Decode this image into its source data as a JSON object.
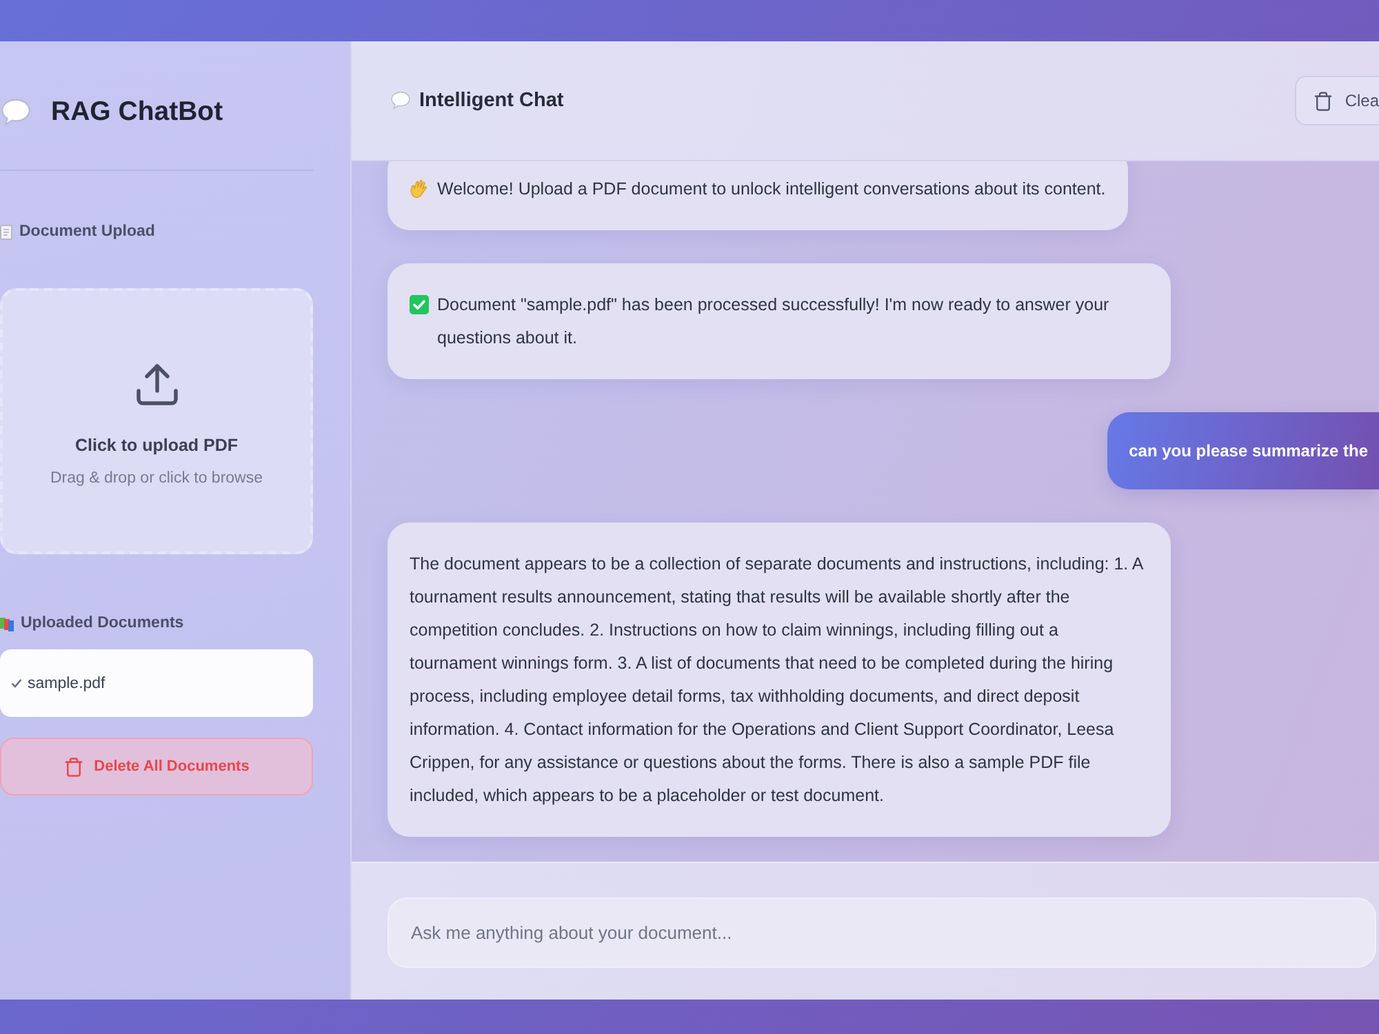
{
  "sidebar": {
    "title": "RAG ChatBot",
    "upload_section": {
      "heading": "Document Upload",
      "dropzone": {
        "title": "Click to upload PDF",
        "hint": "Drag & drop or click to browse"
      }
    },
    "documents_section": {
      "heading": "Uploaded Documents",
      "documents": [
        {
          "name": "sample.pdf",
          "processed": true
        }
      ]
    },
    "delete_button": "Delete All Documents"
  },
  "chat": {
    "title": "Intelligent Chat",
    "clear_button": "Clea",
    "messages": [
      {
        "kind": "welcome",
        "text": "Welcome! Upload a PDF document to unlock intelligent conversations about its content."
      },
      {
        "kind": "success",
        "text": "Document \"sample.pdf\" has been processed successfully! I'm now ready to answer your questions about it."
      },
      {
        "kind": "user",
        "text": "can you please summarize the"
      },
      {
        "kind": "bot",
        "text": "The document appears to be a collection of separate documents and instructions, including: 1. A tournament results announcement, stating that results will be available shortly after the competition concludes. 2. Instructions on how to claim winnings, including filling out a tournament winnings form. 3. A list of documents that need to be completed during the hiring process, including employee detail forms, tax withholding documents, and direct deposit information. 4. Contact information for the Operations and Client Support Coordinator, Leesa Crippen, for any assistance or questions about the forms. There is also a sample PDF file included, which appears to be a placeholder or test document."
      }
    ],
    "input": {
      "placeholder": "Ask me anything about your document..."
    }
  }
}
